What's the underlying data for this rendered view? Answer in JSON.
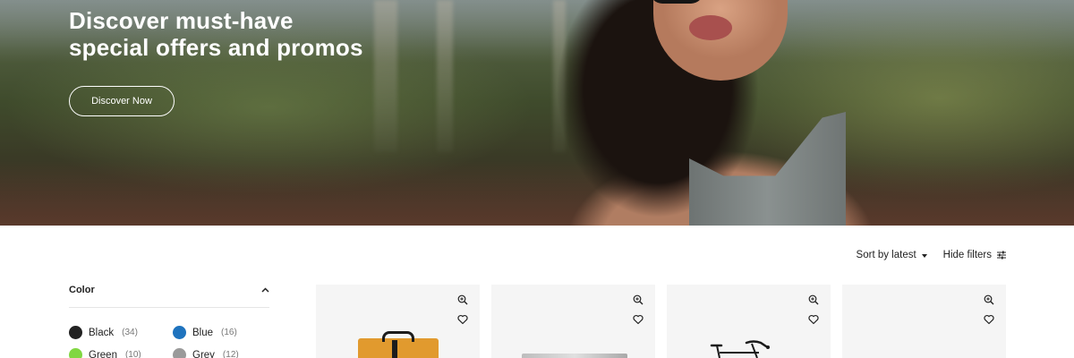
{
  "hero": {
    "title_line1": "Discover must-have",
    "title_line2": "special offers and promos",
    "cta_label": "Discover Now"
  },
  "toolbar": {
    "sort_label": "Sort by latest",
    "filters_label": "Hide filters"
  },
  "filters": {
    "color": {
      "title": "Color",
      "expanded": true,
      "options": [
        {
          "name": "Black",
          "count": "(34)",
          "color": "#222222"
        },
        {
          "name": "Blue",
          "count": "(16)",
          "color": "#1e73be"
        },
        {
          "name": "Green",
          "count": "(10)",
          "color": "#81d742"
        },
        {
          "name": "Grey",
          "count": "(12)",
          "color": "#9a9a9a"
        }
      ]
    }
  },
  "products": [
    {
      "image": "orange-backpack"
    },
    {
      "image": "grey-product"
    },
    {
      "image": "bicycle"
    },
    {
      "image": "empty"
    }
  ],
  "icons": {
    "zoom": "magnify-plus-icon",
    "wishlist": "heart-icon",
    "filters": "sliders-icon",
    "collapse": "chevron-up-icon"
  }
}
